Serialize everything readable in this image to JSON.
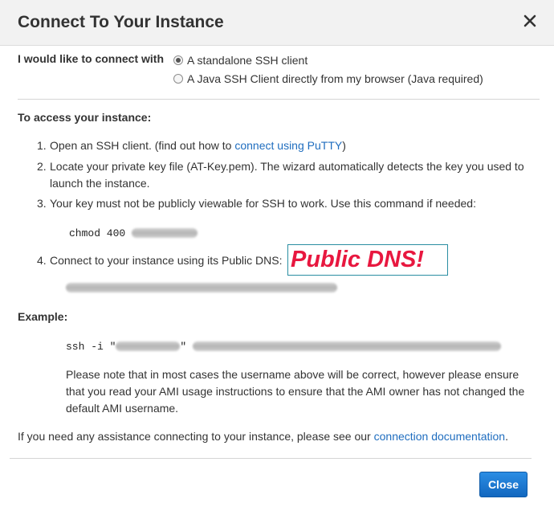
{
  "dialog": {
    "title": "Connect To Your Instance"
  },
  "connect_with": {
    "label": "I would like to connect with",
    "options": [
      {
        "label": "A standalone SSH client",
        "selected": true
      },
      {
        "label": "A Java SSH Client directly from my browser (Java required)",
        "selected": false
      }
    ]
  },
  "access": {
    "heading": "To access your instance:",
    "steps": [
      {
        "num": "1.",
        "text": "Open an SSH client. (find out how to ",
        "link": "connect using PuTTY",
        "after": ")"
      },
      {
        "num": "2.",
        "text": "Locate your private key file (AT-Key.pem). The wizard automatically detects the key you used to launch the instance."
      },
      {
        "num": "3.",
        "text": "Your key must not be publicly viewable for SSH to work. Use this command if needed:"
      },
      {
        "num": "4.",
        "text": "Connect to your instance using its Public DNS:"
      }
    ],
    "chmod_cmd": "chmod 400",
    "annotation": "Public DNS!"
  },
  "example": {
    "heading": "Example:",
    "ssh_prefix": "ssh -i \"",
    "ssh_quote": "\"",
    "note": "Please note that in most cases the username above will be correct, however please ensure that you read your AMI usage instructions to ensure that the AMI owner has not changed the default AMI username."
  },
  "assistance": {
    "text": "If you need any assistance connecting to your instance, please see our ",
    "link": "connection documentation",
    "after": "."
  },
  "footer": {
    "close_label": "Close"
  },
  "colors": {
    "link": "#1f6dbf",
    "annotation": "#e8173f",
    "button": "#1a73cc"
  }
}
